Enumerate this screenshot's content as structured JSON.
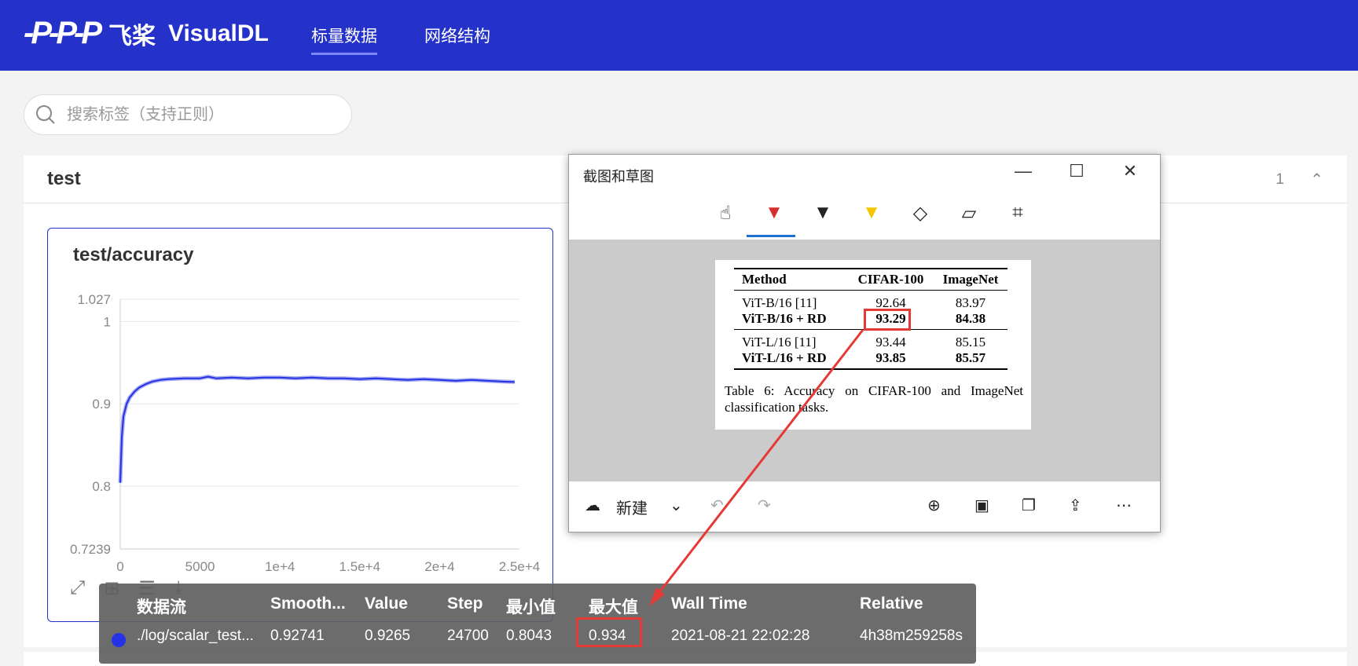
{
  "app": {
    "logo_mark": "-P-P-P",
    "logo_cn": "飞桨",
    "logo_en": "VisualDL",
    "nav": [
      "标量数据",
      "网络结构"
    ]
  },
  "search": {
    "placeholder": "搜索标签（支持正则）"
  },
  "group": {
    "title": "test",
    "count": "1",
    "toggle_icon": "chevron-up"
  },
  "card": {
    "title": "test/accuracy",
    "tools": [
      "expand-icon",
      "grid-icon",
      "list-icon",
      "download-icon"
    ]
  },
  "chart_data": {
    "type": "line",
    "title": "test/accuracy",
    "xlabel": "",
    "ylabel": "",
    "xlim": [
      0,
      25000
    ],
    "ylim": [
      0.7239,
      1.027
    ],
    "xticks": [
      "0",
      "5000",
      "1e+4",
      "1.5e+4",
      "2e+4",
      "2.5e+4"
    ],
    "yticks": [
      "0.7239",
      "0.8",
      "0.9",
      "1",
      "1.027"
    ],
    "grid": true,
    "series": [
      {
        "color": "#2532e5",
        "x": [
          0,
          100,
          200,
          400,
          600,
          900,
          1200,
          1600,
          2000,
          2500,
          3000,
          4000,
          5000,
          5500,
          6000,
          7000,
          8000,
          9000,
          10000,
          11000,
          12000,
          13000,
          14000,
          15000,
          16000,
          17000,
          18000,
          19000,
          20000,
          21000,
          22000,
          23000,
          24000,
          24700
        ],
        "values": [
          0.8043,
          0.86,
          0.885,
          0.9,
          0.908,
          0.915,
          0.92,
          0.924,
          0.927,
          0.929,
          0.93,
          0.931,
          0.931,
          0.933,
          0.931,
          0.932,
          0.931,
          0.932,
          0.932,
          0.931,
          0.932,
          0.931,
          0.931,
          0.93,
          0.931,
          0.93,
          0.929,
          0.93,
          0.929,
          0.928,
          0.929,
          0.928,
          0.927,
          0.9265
        ]
      }
    ]
  },
  "tooltip": {
    "headers": [
      "数据流",
      "Smooth...",
      "Value",
      "Step",
      "最小值",
      "最大值",
      "Wall Time",
      "Relative"
    ],
    "row": [
      "./log/scalar_test...",
      "0.92741",
      "0.9265",
      "24700",
      "0.8043",
      "0.934",
      "2021-08-21 22:02:28",
      "4h38m259258s"
    ],
    "dot_color": "#2532e5"
  },
  "snip": {
    "title": "截图和草图",
    "window_buttons": [
      "—",
      "☐",
      "✕"
    ],
    "tools": [
      "touch-writing-icon",
      "ballpoint-pen-icon",
      "pencil-icon",
      "highlighter-icon",
      "eraser-icon",
      "ruler-icon",
      "crop-icon"
    ],
    "paper": {
      "headers": [
        "Method",
        "CIFAR-100",
        "ImageNet"
      ],
      "rows": [
        [
          "ViT-B/16 [11]",
          "92.64",
          "83.97"
        ],
        [
          "ViT-B/16 + RD",
          "93.29",
          "84.38"
        ],
        [
          "ViT-L/16 [11]",
          "93.44",
          "85.15"
        ],
        [
          "ViT-L/16 + RD",
          "93.85",
          "85.57"
        ]
      ],
      "caption": "Table 6:  Accuracy on CIFAR-100 and ImageNet classification tasks."
    },
    "bottom": {
      "new_label": "新建",
      "icons": [
        "new-snip-icon",
        "chevron-down-icon",
        "undo-icon",
        "redo-icon",
        "zoom-icon",
        "save-icon",
        "copy-icon",
        "share-icon",
        "more-icon"
      ]
    }
  }
}
